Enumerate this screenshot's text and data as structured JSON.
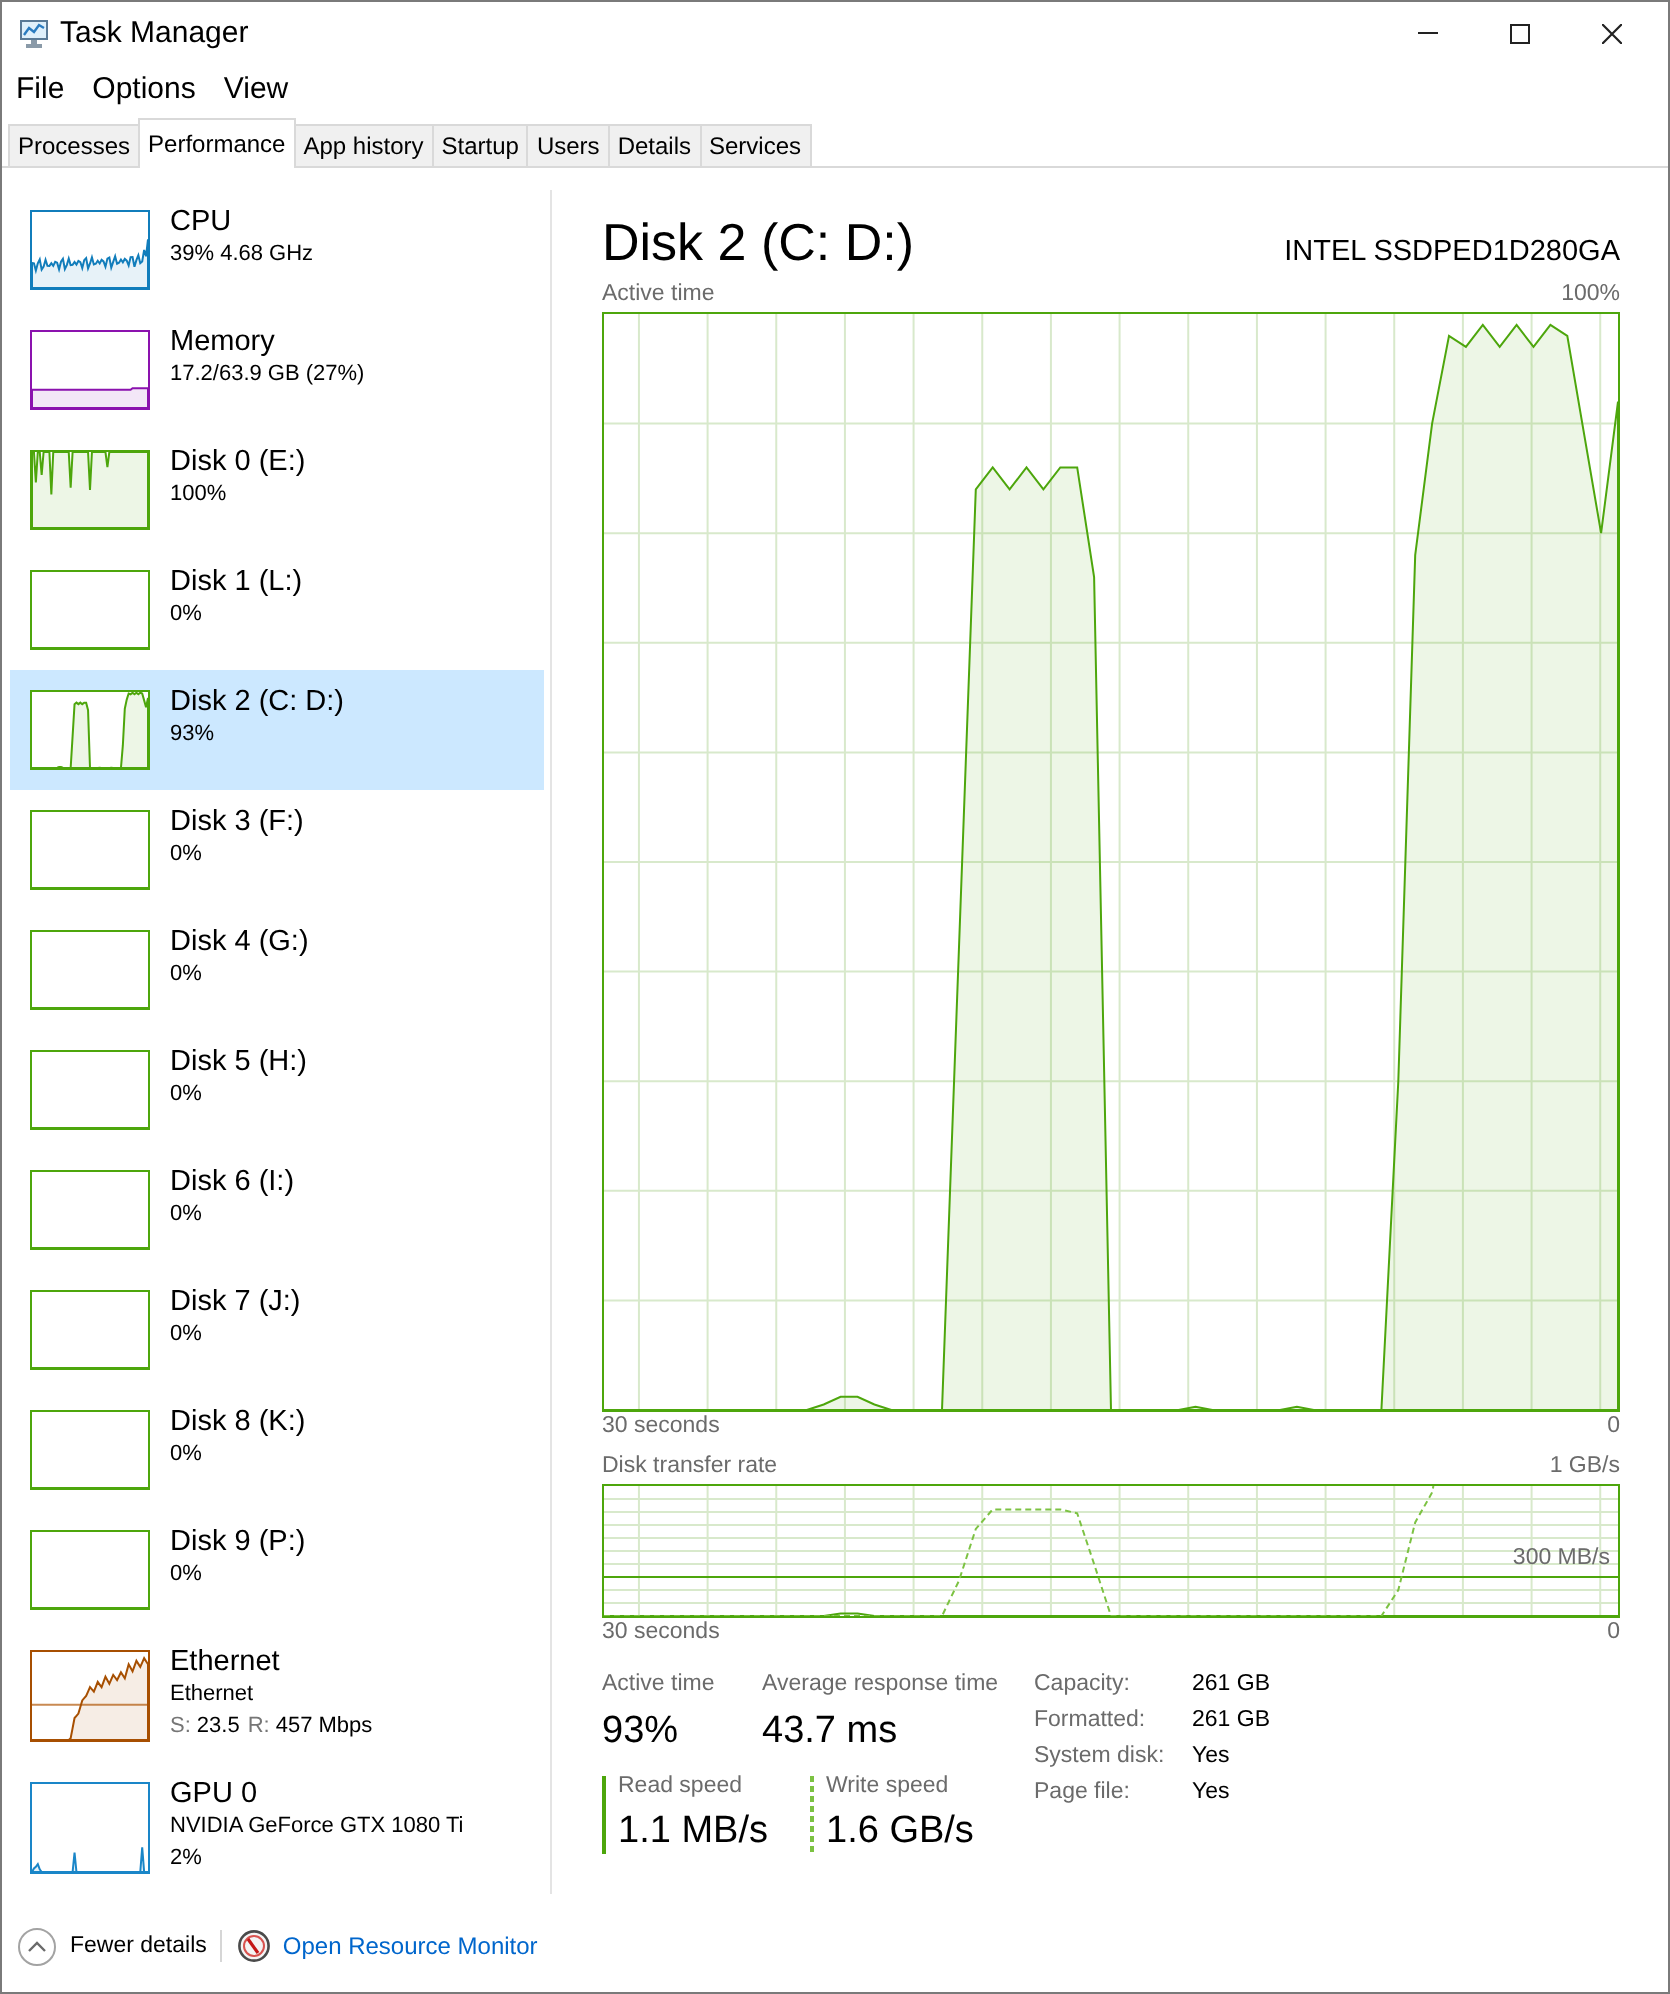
{
  "window": {
    "title": "Task Manager"
  },
  "menu": [
    "File",
    "Options",
    "View"
  ],
  "tabs": [
    {
      "label": "Processes",
      "selected": false
    },
    {
      "label": "Performance",
      "selected": true
    },
    {
      "label": "App history",
      "selected": false
    },
    {
      "label": "Startup",
      "selected": false
    },
    {
      "label": "Users",
      "selected": false
    },
    {
      "label": "Details",
      "selected": false
    },
    {
      "label": "Services",
      "selected": false
    }
  ],
  "sidebar": {
    "items": [
      {
        "kind": "cpu",
        "name": "CPU",
        "details": [
          "39% 4.68 GHz"
        ],
        "selected": false
      },
      {
        "kind": "memory",
        "name": "Memory",
        "details": [
          "17.2/63.9 GB (27%)"
        ],
        "selected": false
      },
      {
        "kind": "disk",
        "name": "Disk 0 (E:)",
        "details": [
          "100%"
        ],
        "selected": false
      },
      {
        "kind": "disk",
        "name": "Disk 1 (L:)",
        "details": [
          "0%"
        ],
        "selected": false
      },
      {
        "kind": "disk",
        "name": "Disk 2 (C: D:)",
        "details": [
          "93%"
        ],
        "selected": true
      },
      {
        "kind": "disk",
        "name": "Disk 3 (F:)",
        "details": [
          "0%"
        ],
        "selected": false
      },
      {
        "kind": "disk",
        "name": "Disk 4 (G:)",
        "details": [
          "0%"
        ],
        "selected": false
      },
      {
        "kind": "disk",
        "name": "Disk 5 (H:)",
        "details": [
          "0%"
        ],
        "selected": false
      },
      {
        "kind": "disk",
        "name": "Disk 6 (I:)",
        "details": [
          "0%"
        ],
        "selected": false
      },
      {
        "kind": "disk",
        "name": "Disk 7 (J:)",
        "details": [
          "0%"
        ],
        "selected": false
      },
      {
        "kind": "disk",
        "name": "Disk 8 (K:)",
        "details": [
          "0%"
        ],
        "selected": false
      },
      {
        "kind": "disk",
        "name": "Disk 9 (P:)",
        "details": [
          "0%"
        ],
        "selected": false
      },
      {
        "kind": "ethernet",
        "name": "Ethernet",
        "details": [
          "Ethernet"
        ],
        "rates": [
          {
            "label": "S:",
            "value": "23.5"
          },
          {
            "label": "R:",
            "value": "457 Mbps"
          }
        ],
        "selected": false
      },
      {
        "kind": "gpu",
        "name": "GPU 0",
        "details": [
          "NVIDIA GeForce GTX 1080 Ti",
          "2%"
        ],
        "selected": false
      }
    ]
  },
  "detail": {
    "title": "Disk 2 (C: D:)",
    "model": "INTEL SSDPED1D280GA",
    "graphs": [
      {
        "kind": "activity",
        "title": "Active time",
        "top_label": "100%",
        "bottom_left_label": "30 seconds",
        "bottom_right_label": "0"
      },
      {
        "kind": "transfer",
        "title": "Disk transfer rate",
        "top_label": "1 GB/s",
        "scale_label": "300 MB/s",
        "bottom_left_label": "30 seconds",
        "bottom_right_label": "0"
      }
    ],
    "metrics": [
      {
        "label": "Active time",
        "value": "93%"
      },
      {
        "label": "Average response time",
        "value": "43.7 ms"
      }
    ],
    "speeds": [
      {
        "label": "Read speed",
        "value": "1.1 MB/s",
        "dashed": false
      },
      {
        "label": "Write speed",
        "value": "1.6 GB/s",
        "dashed": true
      }
    ],
    "properties": [
      {
        "label": "Capacity:",
        "value": "261 GB"
      },
      {
        "label": "Formatted:",
        "value": "261 GB"
      },
      {
        "label": "System disk:",
        "value": "Yes"
      },
      {
        "label": "Page file:",
        "value": "Yes"
      }
    ]
  },
  "footer": {
    "toggle": "Fewer details",
    "link": "Open Resource Monitor"
  }
}
